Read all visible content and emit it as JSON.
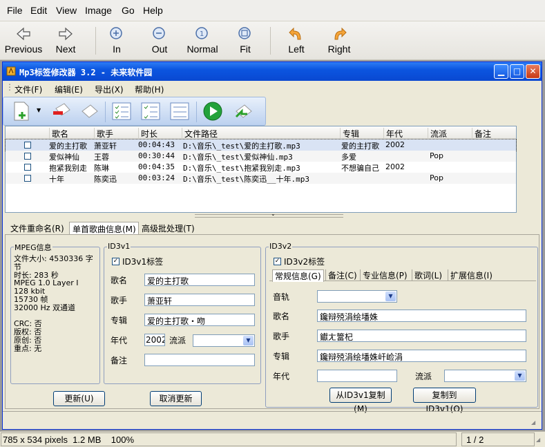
{
  "viewer": {
    "menu": [
      "File",
      "Edit",
      "View",
      "Image",
      "Go",
      "Help"
    ],
    "toolbar": {
      "previous": "Previous",
      "next": "Next",
      "zoom_in": "In",
      "zoom_out": "Out",
      "normal": "Normal",
      "fit": "Fit",
      "rotate_left": "Left",
      "rotate_right": "Right"
    },
    "status": {
      "info": "785 x 534 pixels  1.2 MB    100%",
      "page": "1 / 2"
    }
  },
  "app": {
    "title": "Mp3标签修改器 3.2 - 未来软件园",
    "menu": [
      "文件(F)",
      "编辑(E)",
      "导出(X)",
      "帮助(H)"
    ],
    "columns": [
      "歌名",
      "歌手",
      "时长",
      "文件路径",
      "专辑",
      "年代",
      "流派",
      "备注"
    ],
    "rows": [
      {
        "name": "爱的主打歌",
        "artist": "萧亚轩",
        "duration": "00:04:43",
        "path": "D:\\音乐\\_test\\爱的主打歌.mp3",
        "album": "爱的主打歌",
        "year": "2002",
        "genre": "",
        "note": ""
      },
      {
        "name": "爱似神仙",
        "artist": "王蓉",
        "duration": "00:30:44",
        "path": "D:\\音乐\\_test\\爱似神仙.mp3",
        "album": "多爱",
        "year": "",
        "genre": "Pop",
        "note": ""
      },
      {
        "name": "抱紧我别走",
        "artist": "陈琳",
        "duration": "00:04:35",
        "path": "D:\\音乐\\_test\\抱紧我别走.mp3",
        "album": "不想骗自己",
        "year": "2002",
        "genre": "",
        "note": ""
      },
      {
        "name": "十年",
        "artist": "陈奕迅",
        "duration": "00:03:24",
        "path": "D:\\音乐\\_test\\陈奕迅__十年.mp3",
        "album": "",
        "year": "",
        "genre": "Pop",
        "note": ""
      }
    ],
    "tabs": [
      "文件重命名(R)",
      "单首歌曲信息(M)",
      "高级批处理(T)"
    ],
    "mpeg": {
      "legend": "MPEG信息",
      "lines": [
        "文件大小: 4530336 字",
        "节",
        "时长: 283 秒",
        "MPEG 1.0  Layer I",
        "128 kbit",
        "15730 帧",
        "32000 Hz 双通道",
        "",
        "CRC: 否",
        "版权: 否",
        "原创: 否",
        "重点: 无"
      ]
    },
    "id3v1": {
      "legend": "ID3v1",
      "check_label": "ID3v1标签",
      "title_label": "歌名",
      "title": "爱的主打歌",
      "artist_label": "歌手",
      "artist": "萧亚轩",
      "album_label": "专辑",
      "album": "爱的主打歌・吻",
      "year_label": "年代",
      "year": "2002",
      "genre_label": "流派",
      "comment_label": "备注",
      "comment": ""
    },
    "id3v2": {
      "legend": "ID3v2",
      "check_label": "ID3v2标签",
      "subtabs": [
        "常规信息(G)",
        "备注(C)",
        "专业信息(P)",
        "歌词(L)",
        "扩展信息(I)"
      ],
      "track_label": "音轨",
      "title_label": "歌名",
      "title": "鑱辩殑涓绘墦姝",
      "artist_label": "歌手",
      "artist": "钀ㄤ簹杞",
      "album_label": "专辑",
      "album": "鑱辩殑涓绘墦姝屽崄涓",
      "year_label": "年代",
      "genre_label": "流派",
      "copy_from_v1": "从ID3v1复制(M)",
      "copy_to_v1": "复制到ID3v1(O)"
    },
    "buttons": {
      "update": "更新(U)",
      "cancel": "取消更新"
    }
  }
}
